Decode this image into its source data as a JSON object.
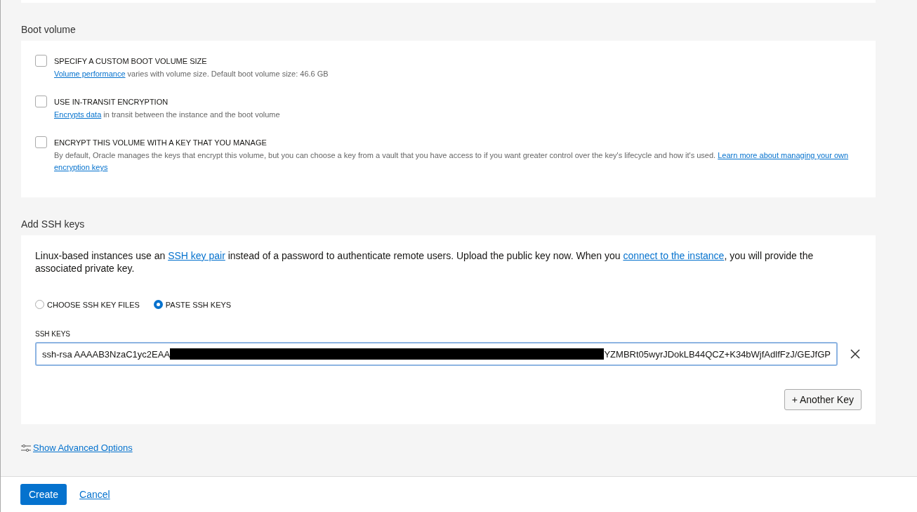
{
  "boot_volume": {
    "title": "Boot volume",
    "options": [
      {
        "label": "SPECIFY A CUSTOM BOOT VOLUME SIZE",
        "checked": false,
        "description": [
          {
            "kind": "link",
            "text": "Volume performance"
          },
          {
            "kind": "text",
            "text": " varies with volume size. Default boot volume size: 46.6 GB"
          }
        ]
      },
      {
        "label": "USE IN-TRANSIT ENCRYPTION",
        "checked": false,
        "description": [
          {
            "kind": "link",
            "text": "Encrypts data"
          },
          {
            "kind": "text",
            "text": " in transit between the instance and the boot volume"
          }
        ]
      },
      {
        "label": "ENCRYPT THIS VOLUME WITH A KEY THAT YOU MANAGE",
        "checked": false,
        "description": [
          {
            "kind": "text",
            "text": "By default, Oracle manages the keys that encrypt this volume, but you can choose a key from a vault that you have access to if you want greater control over the key's lifecycle and how it's used. "
          },
          {
            "kind": "link",
            "text": "Learn more about managing your own"
          },
          {
            "kind": "link",
            "text": "encryption keys"
          }
        ]
      }
    ]
  },
  "ssh_keys": {
    "title": "Add SSH keys",
    "intro": [
      {
        "kind": "text",
        "text": "Linux-based instances use an "
      },
      {
        "kind": "link",
        "text": "SSH key pair"
      },
      {
        "kind": "text",
        "text": " instead of a password to authenticate remote users. Upload the public key now. When you "
      },
      {
        "kind": "link",
        "text": "connect to the instance"
      },
      {
        "kind": "text",
        "text": ", you will provide the associated private key."
      }
    ],
    "source_options": [
      {
        "label": "CHOOSE SSH KEY FILES",
        "selected": false
      },
      {
        "label": "PASTE SSH KEYS",
        "selected": true
      }
    ],
    "field": {
      "label": "SSH KEYS",
      "value_start": "ssh-rsa AAAAB3NzaC1yc2EAA",
      "value_end": "YZMBRt05wyrJDokLB44QCZ+K34bWjfAdlfFzJ/GEJfGP"
    },
    "add_button": "+ Another Key"
  },
  "advanced_link": "Show Advanced Options",
  "footer": {
    "primary": "Create",
    "secondary": "Cancel"
  }
}
